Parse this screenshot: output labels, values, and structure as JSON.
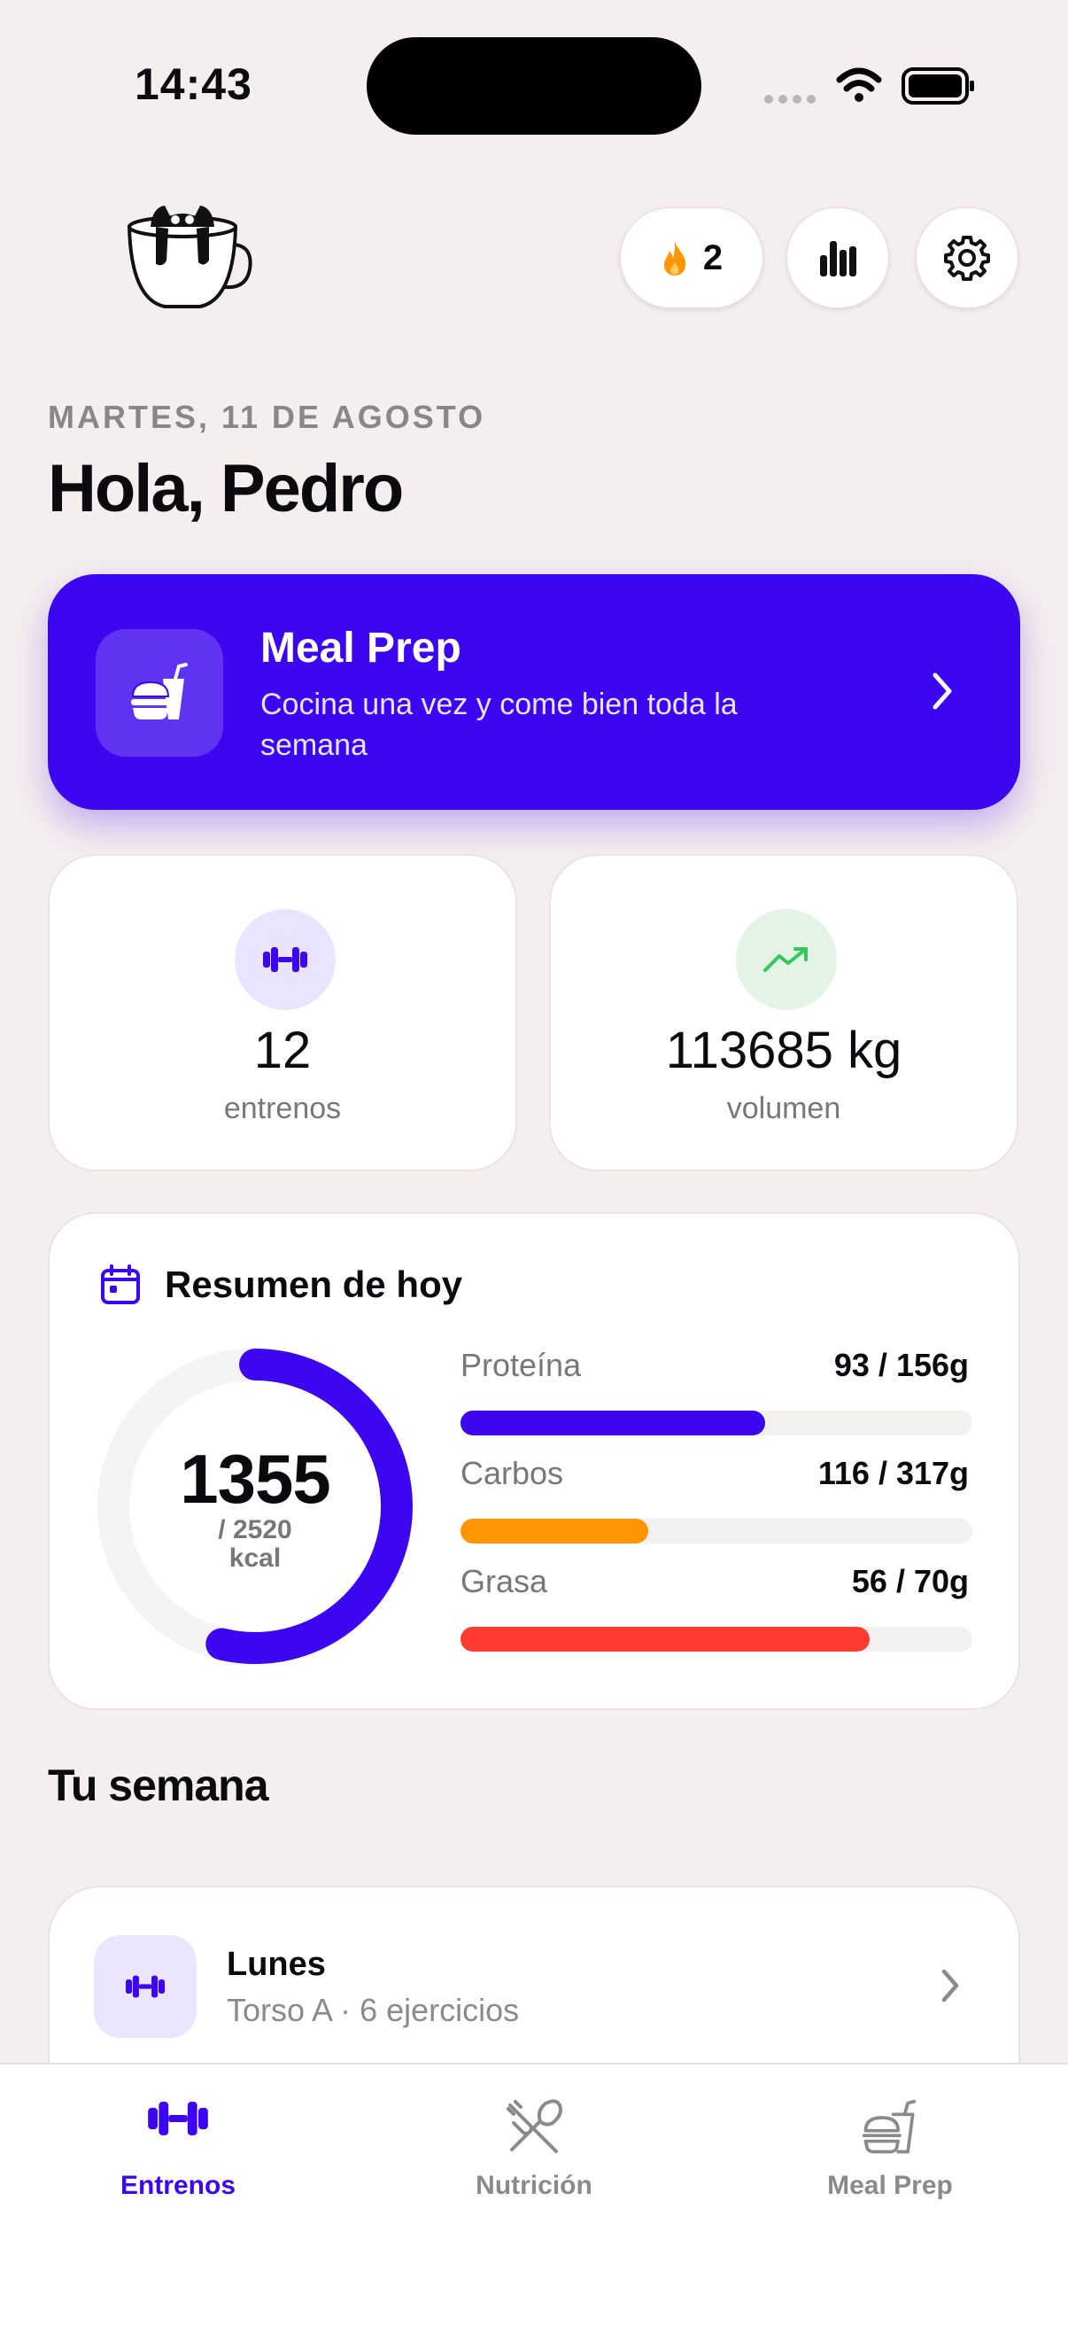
{
  "status_bar": {
    "time": "14:43"
  },
  "header": {
    "streak_count": "2",
    "date": "MARTES, 11 DE AGOSTO",
    "greeting": "Hola, Pedro"
  },
  "banner": {
    "title": "Meal Prep",
    "subtitle": "Cocina una vez y come bien toda la semana"
  },
  "stats": [
    {
      "value": "12",
      "label": "entrenos"
    },
    {
      "value": "113685 kg",
      "label": "volumen"
    }
  ],
  "summary": {
    "title": "Resumen de hoy",
    "calories": "1355",
    "calories_total": "/ 2520",
    "calories_unit": "kcal",
    "calories_fraction": 0.5377,
    "macros": [
      {
        "name": "Proteína",
        "value": "93 / 156g",
        "fraction": 0.596,
        "color": "#3d06f0"
      },
      {
        "name": "Carbos",
        "value": "116 / 317g",
        "fraction": 0.366,
        "color": "#ff9500"
      },
      {
        "name": "Grasa",
        "value": "56 / 70g",
        "fraction": 0.8,
        "color": "#ff3b30"
      }
    ]
  },
  "week": {
    "title": "Tu semana",
    "days": [
      {
        "name": "Lunes",
        "detail": "Torso A · 6 ejercicios"
      }
    ]
  },
  "tabs": [
    {
      "label": "Entrenos",
      "icon": "dumbbell-icon",
      "active": true
    },
    {
      "label": "Nutrición",
      "icon": "utensils-icon",
      "active": false
    },
    {
      "label": "Meal Prep",
      "icon": "meal-prep-icon",
      "active": false
    }
  ],
  "colors": {
    "accent": "#3d06f0",
    "background": "#f5eeee",
    "streak": "#ff9500",
    "trend": "#34c759"
  }
}
